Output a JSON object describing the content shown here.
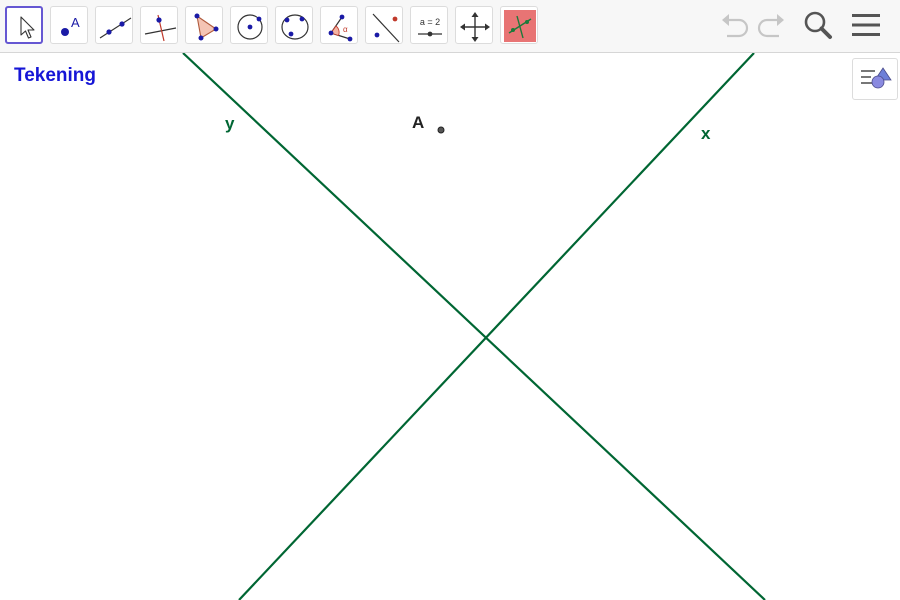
{
  "toolbar": {
    "tools": [
      {
        "name": "move-tool",
        "icon": "arrow-cursor-icon",
        "selected": true
      },
      {
        "name": "point-tool",
        "icon": "point-icon",
        "label": "A"
      },
      {
        "name": "line-tool",
        "icon": "line-through-points-icon"
      },
      {
        "name": "perpendicular-line-tool",
        "icon": "perpendicular-line-icon"
      },
      {
        "name": "polygon-tool",
        "icon": "polygon-icon"
      },
      {
        "name": "circle-center-point-tool",
        "icon": "circle-center-icon"
      },
      {
        "name": "circle-three-points-tool",
        "icon": "circle-three-points-icon"
      },
      {
        "name": "angle-tool",
        "icon": "angle-icon",
        "label": "α"
      },
      {
        "name": "reflect-tool",
        "icon": "reflect-about-line-icon"
      },
      {
        "name": "slider-tool",
        "icon": "slider-icon",
        "label": "a = 2"
      },
      {
        "name": "move-graphics-view-tool",
        "icon": "move-view-icon"
      },
      {
        "name": "custom-tool",
        "icon": "custom-tool-icon"
      }
    ],
    "undo": {
      "icon": "undo-icon"
    },
    "redo": {
      "icon": "redo-icon"
    },
    "search": {
      "icon": "search-icon"
    },
    "menu": {
      "icon": "hamburger-menu-icon"
    }
  },
  "canvas": {
    "title": "Tekening",
    "stylebar_icon": "style-bar-toggle-icon",
    "point": {
      "label": "A"
    },
    "lines": [
      {
        "label": "y",
        "color": "#006633"
      },
      {
        "label": "x",
        "color": "#006633"
      }
    ]
  },
  "colors": {
    "accent": "#6557d2",
    "title": "#1515d6",
    "line": "#006633",
    "point_blue": "#1a1aa6",
    "custom_tool_bg": "#e87474"
  }
}
